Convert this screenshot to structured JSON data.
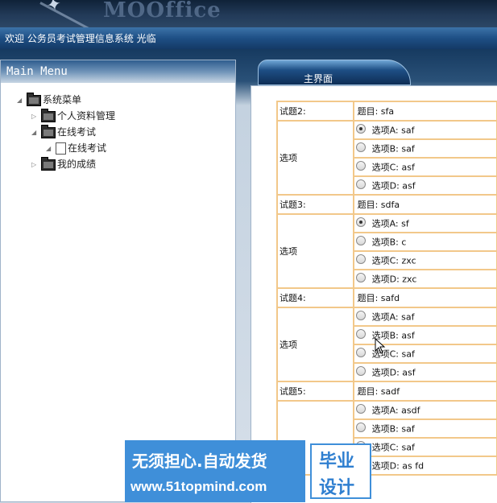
{
  "header": {
    "logo_text": "MOOffice"
  },
  "welcome": {
    "text": "欢迎 公务员考试管理信息系统 光临"
  },
  "sidebar": {
    "title": "Main Menu",
    "tree": [
      {
        "label": "系统菜单",
        "level": 0,
        "icon": "folder-icon",
        "expanded": true
      },
      {
        "label": "个人资料管理",
        "level": 1,
        "icon": "folder-icon",
        "expanded": false
      },
      {
        "label": "在线考试",
        "level": 1,
        "icon": "folder-icon",
        "expanded": true
      },
      {
        "label": "在线考试",
        "level": 2,
        "icon": "document-icon",
        "expanded": true
      },
      {
        "label": "我的成绩",
        "level": 1,
        "icon": "folder-icon",
        "expanded": false
      }
    ]
  },
  "tabs": {
    "main": "主界面"
  },
  "exam": {
    "questions": [
      {
        "label": "试题2:",
        "title": "题目: sfa",
        "options_label": "选项",
        "options": [
          "选项A: saf",
          "选项B: saf",
          "选项C: asf",
          "选项D: asf"
        ],
        "selected": 0
      },
      {
        "label": "试题3:",
        "title": "题目: sdfa",
        "options_label": "选项",
        "options": [
          "选项A: sf",
          "选项B: c",
          "选项C: zxc",
          "选项D: zxc"
        ],
        "selected": 0
      },
      {
        "label": "试题4:",
        "title": "题目: safd",
        "options_label": "选项",
        "options": [
          "选项A: saf",
          "选项B: asf",
          "选项C: saf",
          "选项D: asf"
        ],
        "selected": -1
      },
      {
        "label": "试题5:",
        "title": "题目: sadf",
        "options_label": "",
        "options": [
          "选项A: asdf",
          "选项B: saf",
          "选项C: saf",
          "选项D: as fd"
        ],
        "selected": -1
      }
    ]
  },
  "banner": {
    "line1": "无须担心.自动发货",
    "line2": "www.51topmind.com",
    "right1": "毕业",
    "right2": "设计"
  },
  "colors": {
    "table_border": "#f2c88a",
    "banner_blue": "#3f8fd9",
    "header_dark": "#0f2238"
  }
}
